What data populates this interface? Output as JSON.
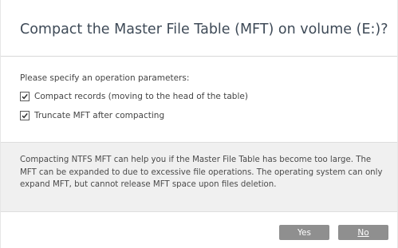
{
  "dialog": {
    "title": "Compact the Master File Table (MFT) on volume (E:)?",
    "prompt": "Please specify an operation parameters:",
    "options": [
      {
        "label": "Compact records (moving to the head of the table)",
        "checked": true
      },
      {
        "label": "Truncate MFT after compacting",
        "checked": true
      }
    ],
    "info": "Compacting NTFS MFT can help you if the Master File Table has become too large. The MFT can be expanded to due to excessive file operations. The operating system can only expand MFT, but cannot release MFT space upon files deletion.",
    "buttons": {
      "yes_label": "Yes",
      "no_label": "No"
    }
  },
  "colors": {
    "button_bg": "#8f8f8f",
    "info_bg": "#f0f0f0",
    "title_text": "#3e4a57"
  }
}
